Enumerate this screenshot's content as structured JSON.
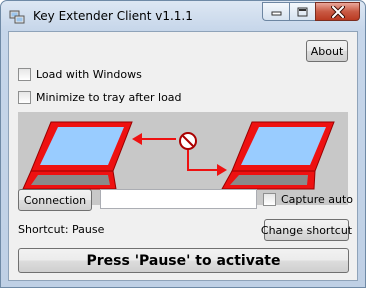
{
  "window": {
    "title": "Key Extender Client v1.1.1",
    "icon": "key-extender-app-icon"
  },
  "caption_buttons": {
    "minimize_icon": "minimize-icon",
    "maximize_icon": "maximize-icon",
    "close_icon": "close-icon"
  },
  "buttons": {
    "about": "About",
    "connection": "Connection",
    "change_shortcut": "Change shortcut",
    "activate": "Press 'Pause' to activate"
  },
  "options": {
    "load_with_windows": {
      "label": "Load with Windows",
      "checked": false
    },
    "minimize_to_tray": {
      "label": "Minimize to tray after load",
      "checked": false
    },
    "capture_auto": {
      "label": "Capture auto",
      "checked": false
    }
  },
  "connection_field": {
    "value": ""
  },
  "shortcut": {
    "label": "Shortcut:",
    "value": "Pause"
  },
  "illustration": {
    "left_laptop_icon": "laptop-icon",
    "right_laptop_icon": "laptop-icon",
    "status_icon": "disconnected-icon",
    "colors": {
      "frame": "#ee1111",
      "screen": "#99ccff",
      "background": "#c8c8c8"
    }
  }
}
